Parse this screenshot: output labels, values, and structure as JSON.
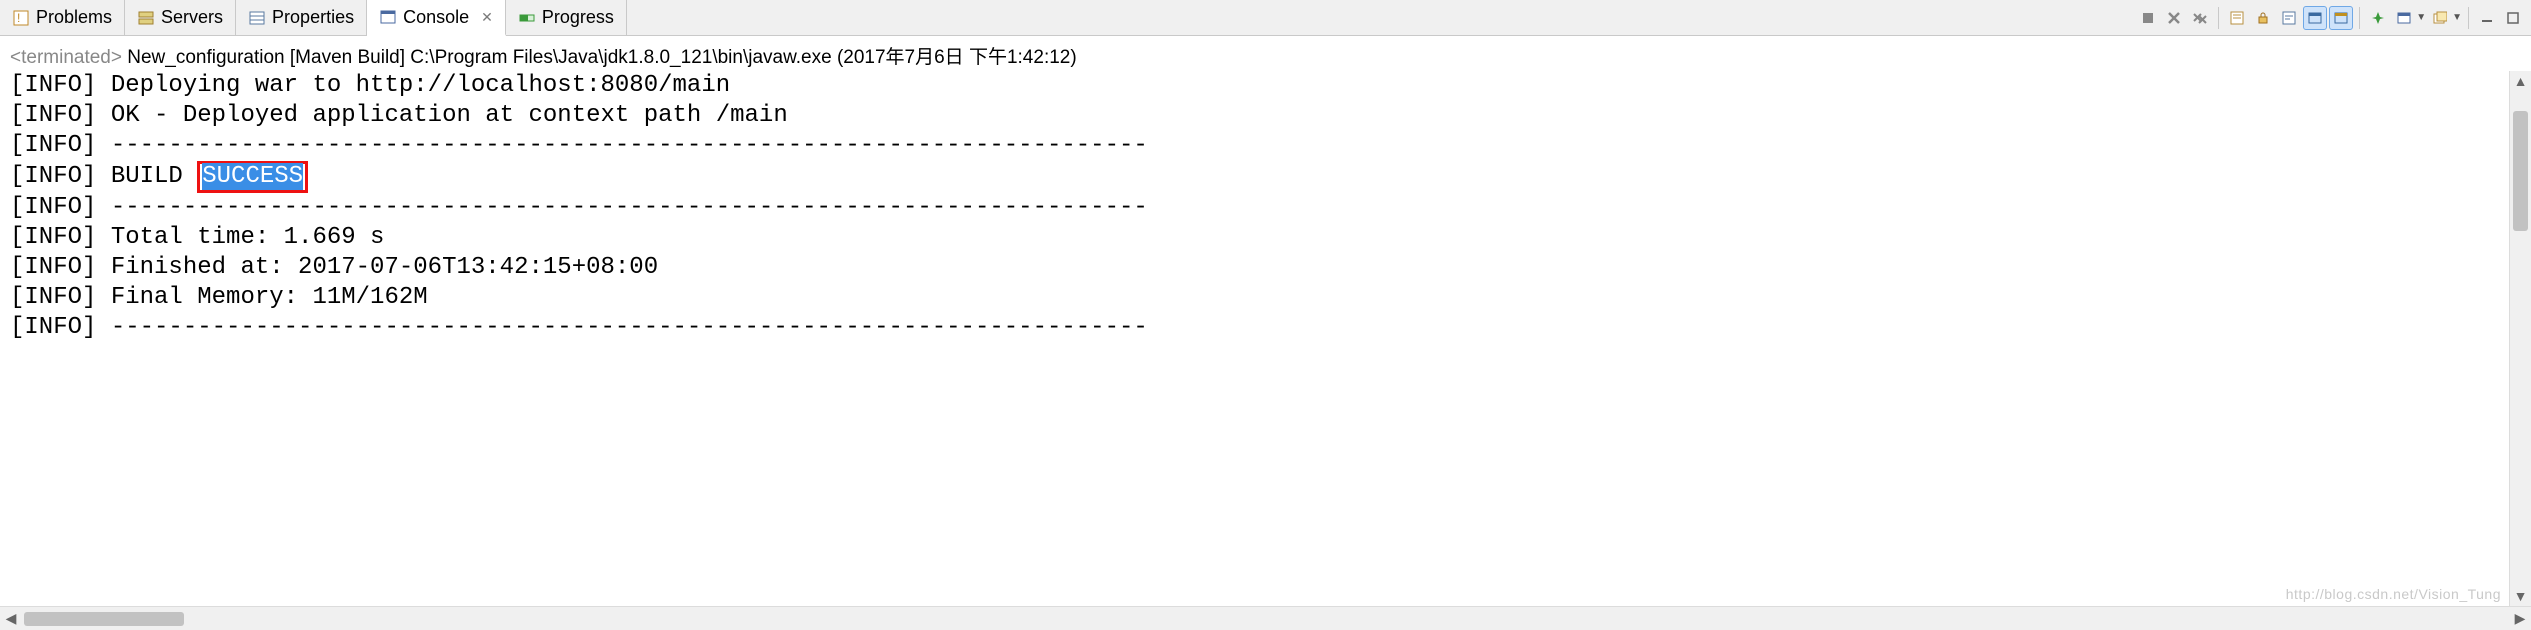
{
  "tabs": {
    "problems": "Problems",
    "servers": "Servers",
    "properties": "Properties",
    "console": "Console",
    "progress": "Progress"
  },
  "icons": {
    "problems": "problems-icon",
    "servers": "servers-icon",
    "properties": "properties-icon",
    "console": "console-icon",
    "progress": "progress-icon"
  },
  "header": {
    "terminated": "<terminated>",
    "rest": " New_configuration [Maven Build] C:\\Program Files\\Java\\jdk1.8.0_121\\bin\\javaw.exe (2017年7月6日 下午1:42:12)"
  },
  "console_lines": [
    {
      "prefix": "[INFO] ",
      "text": "Deploying war to http://localhost:8080/main"
    },
    {
      "prefix": "[INFO] ",
      "text": "OK - Deployed application at context path /main"
    },
    {
      "prefix": "[INFO] ",
      "text": "------------------------------------------------------------------------"
    },
    {
      "prefix": "[INFO] ",
      "text": "BUILD ",
      "highlight_box": "SUCCESS"
    },
    {
      "prefix": "[INFO] ",
      "text": "------------------------------------------------------------------------"
    },
    {
      "prefix": "[INFO] ",
      "text": "Total time: 1.669 s"
    },
    {
      "prefix": "[INFO] ",
      "text": "Finished at: 2017-07-06T13:42:15+08:00"
    },
    {
      "prefix": "[INFO] ",
      "text": "Final Memory: 11M/162M"
    },
    {
      "prefix": "[INFO] ",
      "text": "------------------------------------------------------------------------"
    }
  ],
  "watermark": "http://blog.csdn.net/Vision_Tung"
}
